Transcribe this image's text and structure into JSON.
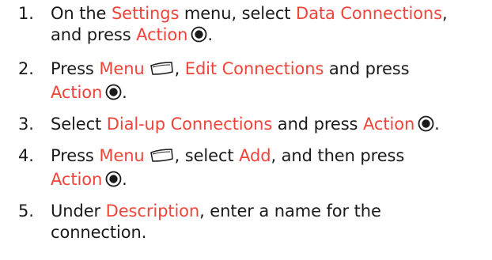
{
  "steps": [
    {
      "number": "1.",
      "parts": [
        "On the ",
        "Settings",
        " menu, select ",
        "Data Connections",
        ",",
        "and press ",
        "Action",
        "."
      ]
    },
    {
      "number": "2.",
      "parts": [
        "Press ",
        "Menu",
        ", ",
        "Edit Connections",
        " and press",
        "Action",
        "."
      ]
    },
    {
      "number": "3.",
      "parts": [
        "Select ",
        "Dial-up Connections",
        " and press ",
        "Action",
        "."
      ]
    },
    {
      "number": "4.",
      "parts": [
        "Press ",
        "Menu",
        ", select ",
        "Add",
        ", and then press",
        "Action",
        "."
      ]
    },
    {
      "number": "5.",
      "parts": [
        "Under ",
        "Description",
        ", enter a name for the",
        "connection."
      ]
    }
  ],
  "icons": {
    "action": "action-button-icon",
    "menu": "menu-softkey-icon"
  },
  "colors": {
    "highlight": "#f0443a",
    "text": "#1a1a1a"
  }
}
